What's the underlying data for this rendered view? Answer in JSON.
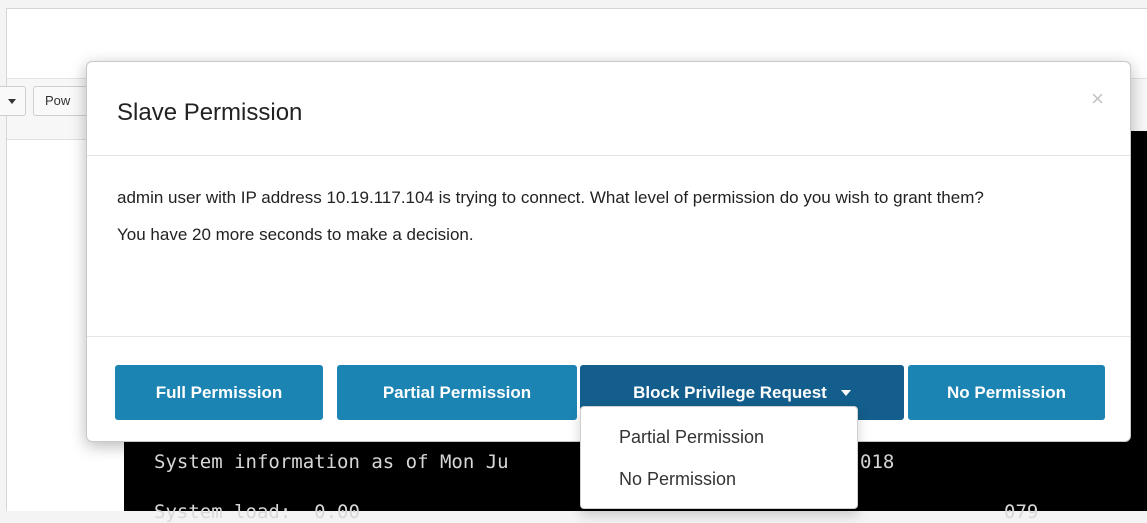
{
  "background": {
    "toolbar": {
      "power_label": "Pow"
    },
    "console": {
      "lines": [
        "System information as of Mon Ju",
        "System load:  0.00"
      ],
      "line1_tail": "018",
      "line2_tail": "079"
    }
  },
  "modal": {
    "title": "Slave Permission",
    "close_symbol": "×",
    "message": "admin user with IP address 10.19.117.104 is trying to connect. What level of permission do you wish to grant them?",
    "countdown": "You have 20 more seconds to make a decision.",
    "buttons": {
      "full": "Full Permission",
      "partial": "Partial Permission",
      "block": "Block Privilege Request",
      "none": "No Permission"
    },
    "dropdown_items": [
      "Partial Permission",
      "No Permission"
    ]
  },
  "colors": {
    "primary_button": "#1b84b3",
    "active_button": "#135e8c",
    "console_bg": "#000000"
  }
}
